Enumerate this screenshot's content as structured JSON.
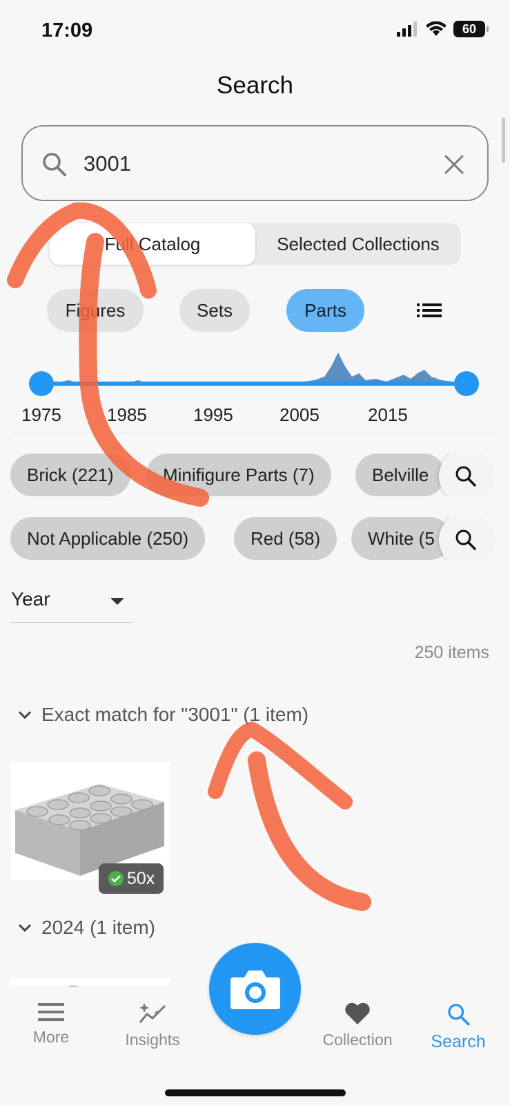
{
  "status_bar": {
    "time": "17:09",
    "battery": "60"
  },
  "page": {
    "title": "Search"
  },
  "search": {
    "value": "3001",
    "placeholder": ""
  },
  "segmented": {
    "options": [
      "Full Catalog",
      "Selected Collections"
    ],
    "selected": "Full Catalog"
  },
  "type_tabs": {
    "items": [
      "Figures",
      "Sets",
      "Parts"
    ],
    "selected": "Parts"
  },
  "year_slider": {
    "ticks": [
      "1975",
      "1985",
      "1995",
      "2005",
      "2015"
    ],
    "range": [
      1975,
      2024
    ]
  },
  "category_chips": [
    "Brick (221)",
    "Minifigure Parts (7)",
    "Belville"
  ],
  "color_chips": [
    "Not Applicable (250)",
    "Red (58)",
    "White (5"
  ],
  "sort": {
    "label": "Year"
  },
  "results": {
    "count_label": "250 items"
  },
  "groups": [
    {
      "title": "Exact match for \"3001\" (1 item)",
      "badge": "50x"
    },
    {
      "title": "2024 (1 item)"
    }
  ],
  "bottom_nav": {
    "items": [
      "More",
      "Insights",
      "Collection",
      "Search"
    ],
    "selected": "Search"
  },
  "colors": {
    "accent": "#2196f3",
    "selected_pill": "#64b4f6",
    "annotation": "#f4623a"
  },
  "icons": [
    "search-icon",
    "close-icon",
    "list-view-icon",
    "chevron-down-icon",
    "check-circle-icon",
    "menu-icon",
    "sparkle-chart-icon",
    "heart-icon",
    "camera-icon"
  ]
}
